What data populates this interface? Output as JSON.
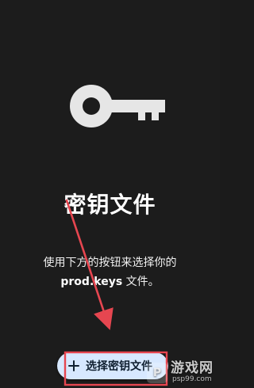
{
  "page": {
    "title": "密钥文件",
    "description": {
      "prefix": "使用下方的按钮来选择你的",
      "file": "prod.keys",
      "suffix": "文件。"
    },
    "select_button_label": "选择密钥文件"
  },
  "icons": {
    "hero": "key-icon",
    "button": "plus-icon"
  },
  "watermark": {
    "logo_text": "P",
    "main": "游戏网",
    "sub": "psp99.com"
  },
  "annotation": {
    "arrow_color": "#e64650",
    "box_color": "#e64650"
  }
}
